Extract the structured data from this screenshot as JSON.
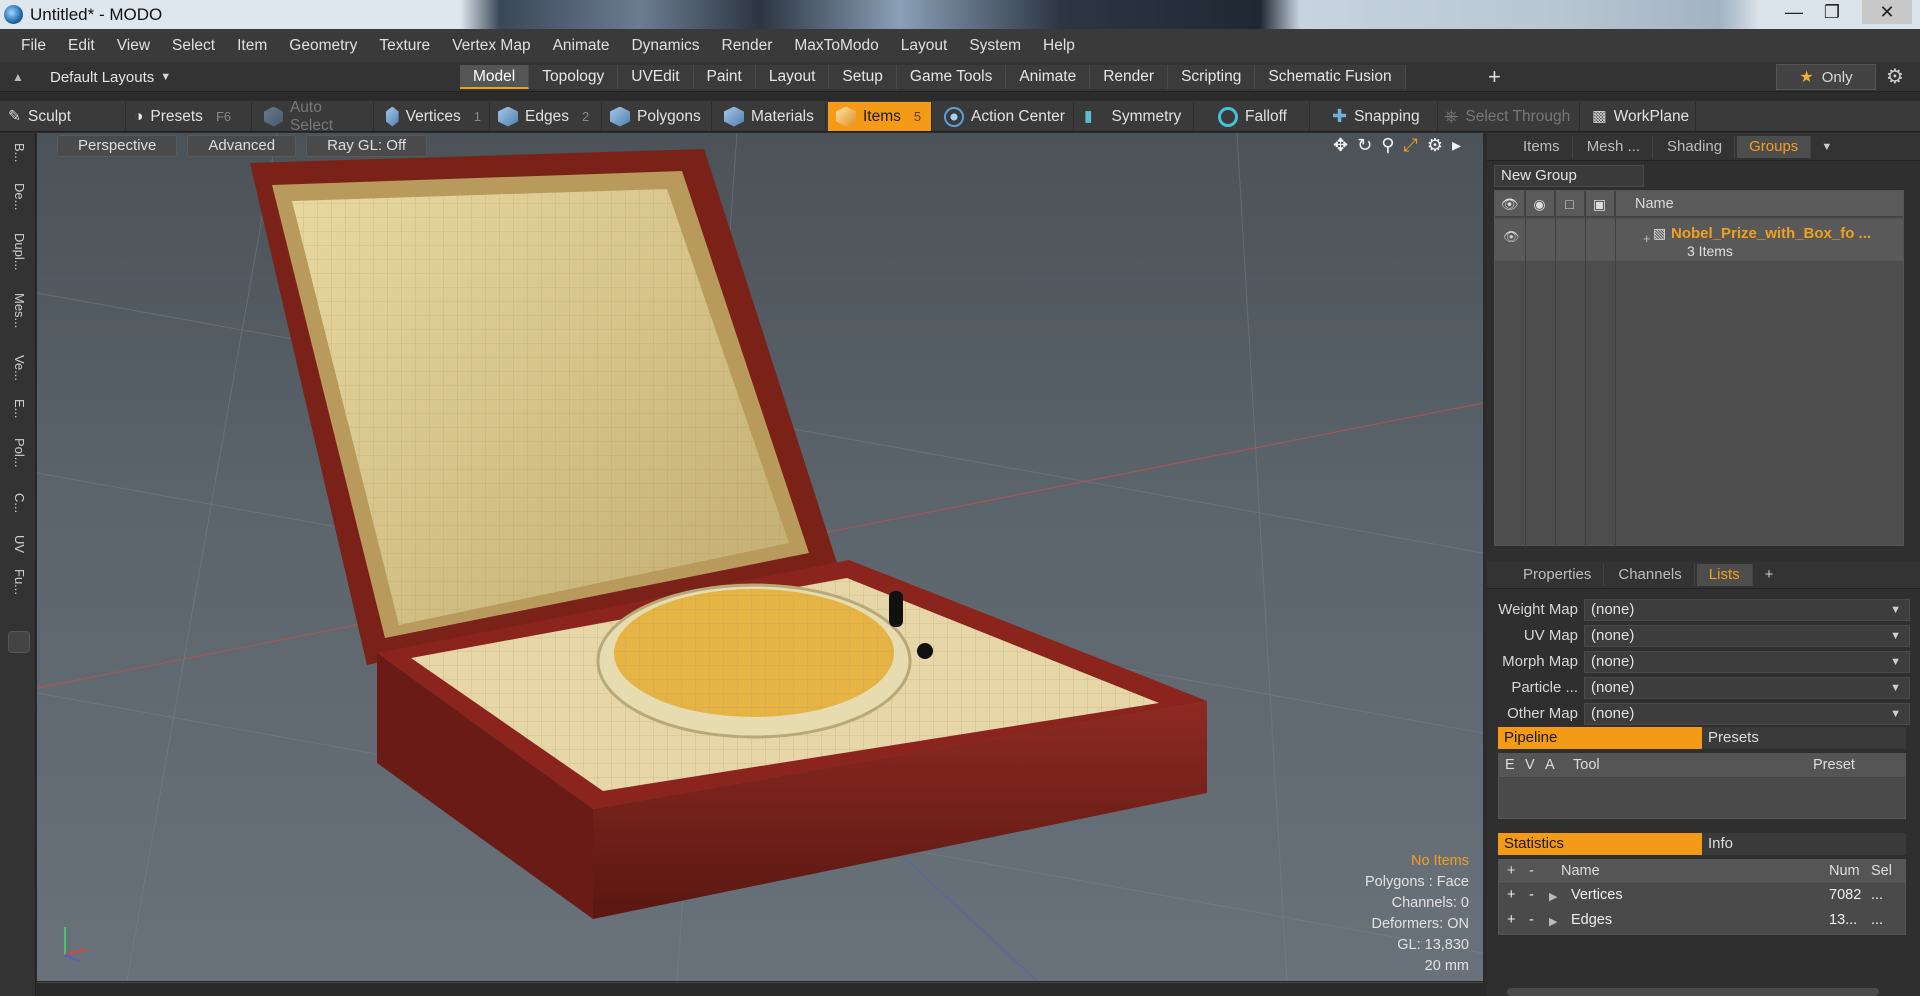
{
  "window": {
    "title": "Untitled* - MODO",
    "controls": [
      "minimize",
      "maximize",
      "close"
    ]
  },
  "menu": [
    "File",
    "Edit",
    "View",
    "Select",
    "Item",
    "Geometry",
    "Texture",
    "Vertex Map",
    "Animate",
    "Dynamics",
    "Render",
    "MaxToModo",
    "Layout",
    "System",
    "Help"
  ],
  "layout_selector": "Default Layouts",
  "mode_tabs": [
    "Model",
    "Topology",
    "UVEdit",
    "Paint",
    "Layout",
    "Setup",
    "Game Tools",
    "Animate",
    "Render",
    "Scripting",
    "Schematic Fusion"
  ],
  "active_mode_tab": "Model",
  "only_button": "Only",
  "tools": {
    "sculpt": "Sculpt",
    "presets": "Presets",
    "presets_key": "F6",
    "auto_select": "Auto Select",
    "vertices": "Vertices",
    "vertices_key": "1",
    "edges": "Edges",
    "edges_key": "2",
    "polygons": "Polygons",
    "materials": "Materials",
    "items": "Items",
    "items_key": "5",
    "action_center": "Action Center",
    "symmetry": "Symmetry",
    "falloff": "Falloff",
    "snapping": "Snapping",
    "select_through": "Select Through",
    "workplane": "WorkPlane"
  },
  "left_strip": [
    "B...",
    "De...",
    "Dupl...",
    "Mes...",
    "Ve...",
    "E...",
    "Pol...",
    "C...",
    "UV",
    "Fu..."
  ],
  "viewport": {
    "buttons": [
      "Perspective",
      "Advanced",
      "Ray GL: Off"
    ],
    "info": {
      "selection": "No Items",
      "polygons": "Polygons : Face",
      "channels": "Channels: 0",
      "deformers": "Deformers: ON",
      "gl": "GL: 13,830",
      "scale": "20 mm"
    }
  },
  "groups_panel": {
    "tabs": [
      "Items",
      "Mesh ...",
      "Shading",
      "Groups"
    ],
    "active_tab": "Groups",
    "new_group": "New Group",
    "column_name": "Name",
    "item_name": "Nobel_Prize_with_Box_fo ...",
    "item_count": "3 Items"
  },
  "lists_panel": {
    "tabs": [
      "Properties",
      "Channels",
      "Lists"
    ],
    "active_tab": "Lists",
    "maps": [
      {
        "label": "Weight Map",
        "value": "(none)"
      },
      {
        "label": "UV Map",
        "value": "(none)"
      },
      {
        "label": "Morph Map",
        "value": "(none)"
      },
      {
        "label": "Particle ...",
        "value": "(none)"
      },
      {
        "label": "Other Map",
        "value": "(none)"
      }
    ],
    "pipeline_tab": "Pipeline",
    "presets_tab": "Presets",
    "pipeline_cols": [
      "E",
      "V",
      "A",
      "Tool",
      "Preset"
    ],
    "statistics_tab": "Statistics",
    "info_tab": "Info",
    "stats_cols": [
      "+",
      "-",
      "Name",
      "Num",
      "Sel"
    ],
    "stats_rows": [
      {
        "plus": "+",
        "minus": "-",
        "name": "Vertices",
        "num": "7082",
        "sel": "..."
      },
      {
        "plus": "+",
        "minus": "-",
        "name": "Edges",
        "num": "13...",
        "sel": "..."
      }
    ]
  }
}
